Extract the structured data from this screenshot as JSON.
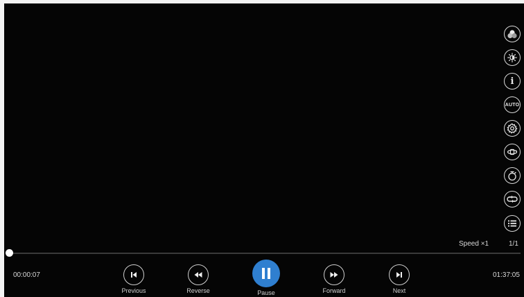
{
  "player": {
    "speed_text": "Speed ×1",
    "page_text": "1/1",
    "current_time": "00:00:07",
    "total_time": "01:37:05",
    "progress": 0.001,
    "accent_color": "#2f7fd0"
  },
  "side_menu": {
    "items": [
      {
        "name": "color-adjust-icon"
      },
      {
        "name": "brightness-icon"
      },
      {
        "name": "info-icon",
        "text": "i"
      },
      {
        "name": "auto-icon",
        "text": "AUTO"
      },
      {
        "name": "settings-gear-icon"
      },
      {
        "name": "rotate-3d-icon"
      },
      {
        "name": "timer-icon"
      },
      {
        "name": "loop-icon"
      },
      {
        "name": "playlist-icon"
      }
    ]
  },
  "controls": {
    "previous": "Previous",
    "reverse": "Reverse",
    "pause": "Pause",
    "forward": "Forward",
    "next": "Next"
  }
}
